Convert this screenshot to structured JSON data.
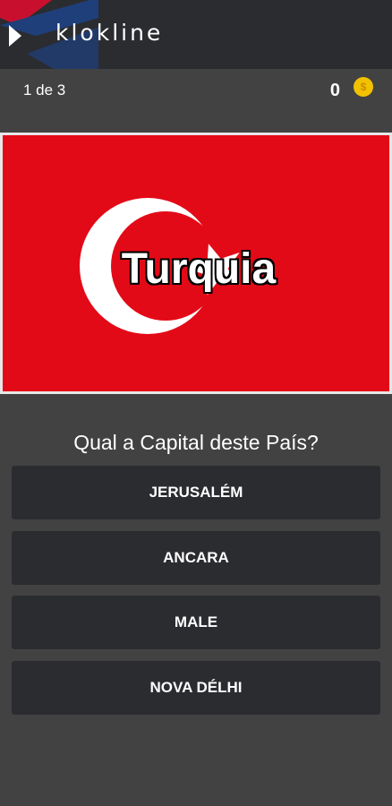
{
  "header": {
    "brand": "klokline"
  },
  "status": {
    "progress": "1 de 3",
    "coins": "0",
    "coin_symbol": "$"
  },
  "flag": {
    "country": "Turquia",
    "colors": {
      "red": "#e30a17",
      "white": "#ffffff"
    }
  },
  "quiz": {
    "question": "Qual a Capital deste País?",
    "answers": [
      "JERUSALÉM",
      "ANCARA",
      "MALE",
      "NOVA DÉLHI"
    ]
  }
}
